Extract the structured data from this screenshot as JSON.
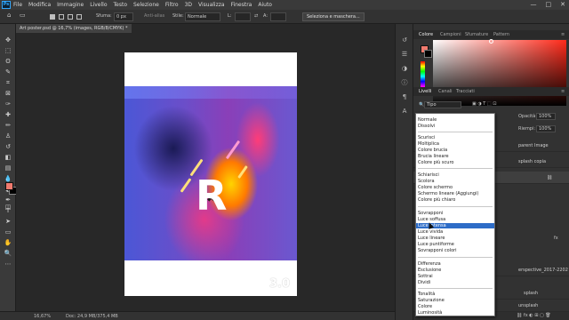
{
  "menubar": {
    "app_icon": "Ps",
    "items": [
      "File",
      "Modifica",
      "Immagine",
      "Livello",
      "Testo",
      "Selezione",
      "Filtro",
      "3D",
      "Visualizza",
      "Finestra",
      "Aiuto"
    ],
    "window_controls": [
      "—",
      "□",
      "✕"
    ]
  },
  "optionsbar": {
    "sfuma_label": "Sfuma:",
    "sfuma_value": "0 px",
    "anti_alias": "Anti-alias",
    "stile_label": "Stile:",
    "stile_value": "Normale",
    "l_label": "L:",
    "a_label": "A:",
    "select_mask_button": "Seleziona e maschera..."
  },
  "document": {
    "tab_title": "Art poster.psd @ 16,7% (images, RGB/8/CMYK) *",
    "poster_logo": "3.0"
  },
  "statusbar": {
    "zoom": "16,67%",
    "doc_info": "Doc: 24,9 MB/375,4 MB"
  },
  "color_panel": {
    "tabs": [
      "Colore",
      "Campioni",
      "Sfumature",
      "Pattern"
    ],
    "active_tab": "Colore",
    "foreground": "#f07a6e",
    "background": "#000000"
  },
  "layers_panel": {
    "tabs": [
      "Livelli",
      "Canali",
      "Tracciati"
    ],
    "active_tab": "Livelli",
    "filter_value": "Tipo",
    "opacity_label": "Opacità:",
    "opacity_value": "100%",
    "fill_label": "Riempi:",
    "fill_value": "100%",
    "layers_visible": [
      "parent Image",
      "splash copia",
      "erspective_2017-2202",
      "splash",
      "unsplash"
    ],
    "fx_label": "fx"
  },
  "blend_dropdown": {
    "groups": [
      [
        "Normale",
        "Dissolvi"
      ],
      [
        "Scurisci",
        "Moltiplica",
        "Colore brucia",
        "Brucia lineare",
        "Colore più scuro"
      ],
      [
        "Schiarisci",
        "Scolora",
        "Colore schermo",
        "Schermo lineare (Aggiungi)",
        "Colore più chiaro"
      ],
      [
        "Sovrapponi",
        "Luce soffusa",
        "Luce intensa",
        "Luce vivida",
        "Luce lineare",
        "Luce puntiforme",
        "Sovrapponi colori"
      ],
      [
        "Differenza",
        "Esclusione",
        "Sottrai",
        "Dividi"
      ],
      [
        "Tonalità",
        "Saturazione",
        "Colore",
        "Luminosità"
      ]
    ],
    "highlighted": "Luce intensa"
  },
  "colors": {
    "accent_highlight": "#2d6cc7",
    "ui_dark": "#282828"
  }
}
